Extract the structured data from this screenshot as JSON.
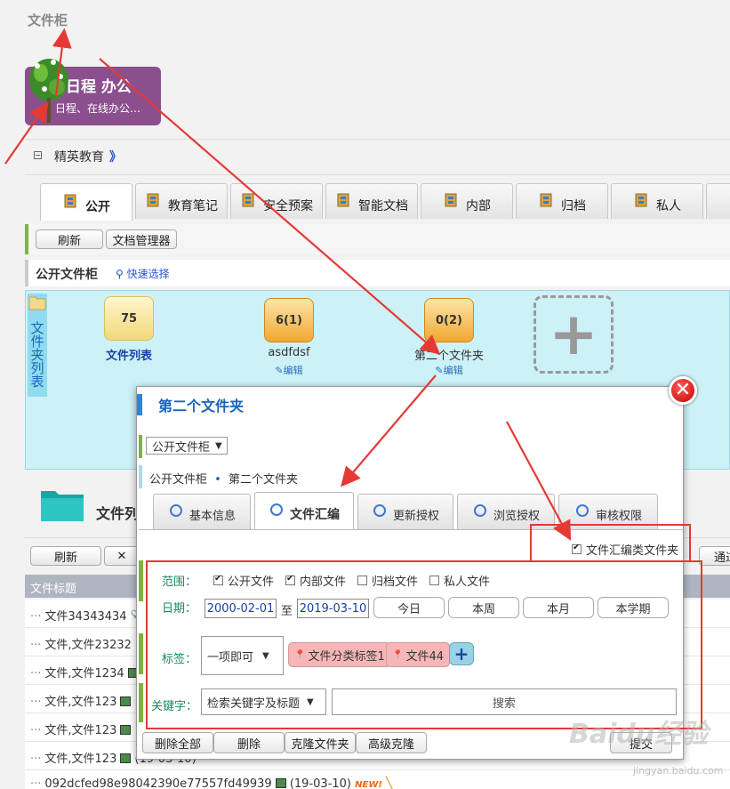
{
  "page": {
    "title": "文件柜"
  },
  "banner": {
    "line1": "日程 办公",
    "line2": "日程、在线办公…"
  },
  "breadcrumb": {
    "label": "精英教育",
    "arrow": "》"
  },
  "tabs": [
    {
      "label": "公开",
      "active": true,
      "icon": "cabinet-icon"
    },
    {
      "label": "教育笔记",
      "icon": "cabinet-icon"
    },
    {
      "label": "安全预案",
      "icon": "cabinet-icon"
    },
    {
      "label": "智能文档",
      "icon": "doc-icon"
    },
    {
      "label": "内部",
      "icon": "cabinet-icon"
    },
    {
      "label": "归档",
      "icon": "cabinet-icon"
    },
    {
      "label": "私人",
      "icon": "cabinet-icon"
    },
    {
      "label": "",
      "icon": "cabinet-icon"
    }
  ],
  "toolbar": {
    "refresh": "刷新",
    "doc_manager": "文档管理器"
  },
  "cabinet": {
    "title": "公开文件柜",
    "quick_select": "快速选择"
  },
  "side_label": "文件夹列表",
  "folders": [
    {
      "count": "75",
      "name": "文件列表"
    },
    {
      "count": "6(1)",
      "name": "asdfdsf",
      "edit": "编辑"
    },
    {
      "count": "0(2)",
      "name": "第二个文件夹",
      "edit": "编辑"
    }
  ],
  "file_list": {
    "title": "文件列",
    "refresh": "刷新",
    "pass": "通过",
    "column": "文件标题",
    "rows": [
      {
        "title": "文件34343434",
        "suffix": ""
      },
      {
        "title": "文件,文件23232",
        "suffix": ""
      },
      {
        "title": "文件,文件1234",
        "suffix": ""
      },
      {
        "title": "文件,文件123",
        "suffix": ""
      },
      {
        "title": "文件,文件123",
        "suffix": ""
      },
      {
        "title": "文件,文件123",
        "suffix": "(19-03-10)"
      },
      {
        "title": "092dcfed98e98042390e77557fd49939",
        "suffix": "(19-03-10)",
        "new": "NEW!"
      }
    ]
  },
  "dialog": {
    "title": "第二个文件夹",
    "cabinet_select": "公开文件柜",
    "path_root": "公开文件柜",
    "path_sep": "•",
    "path_leaf": "第二个文件夹",
    "tabs": [
      {
        "label": "基本信息",
        "icon": "settings-icon"
      },
      {
        "label": "文件汇编",
        "icon": "search-icon",
        "active": true
      },
      {
        "label": "更新授权",
        "icon": "refresh-icon"
      },
      {
        "label": "浏览授权",
        "icon": "key-icon"
      },
      {
        "label": "审核权限",
        "icon": "check-icon"
      }
    ],
    "compile_checkbox": {
      "label": "文件汇编类文件夹",
      "checked": true
    },
    "scope": {
      "label": "范围：",
      "options": [
        {
          "label": "公开文件",
          "checked": true
        },
        {
          "label": "内部文件",
          "checked": true
        },
        {
          "label": "归档文件",
          "checked": false
        },
        {
          "label": "私人文件",
          "checked": false
        }
      ]
    },
    "date": {
      "label": "日期：",
      "from": "2000-02-01",
      "sep": "至",
      "to": "2019-03-10",
      "buttons": [
        "今日",
        "本周",
        "本月",
        "本学期"
      ]
    },
    "tags": {
      "label": "标签：",
      "mode": "一项即可",
      "items": [
        "文件分类标签1",
        "文件44"
      ],
      "add": "+"
    },
    "keyword": {
      "label": "关键字：",
      "field": "检索关键字及标题",
      "search": "搜索"
    },
    "footer": {
      "delete_all": "删除全部",
      "delete": "删除",
      "clone": "克隆文件夹",
      "adv_clone": "高级克隆",
      "submit": "提交"
    }
  },
  "watermark": {
    "text": "Baidu经验",
    "url": "jingyan.baidu.com"
  },
  "colors": {
    "accent_green": "#7cb342",
    "annotation_red": "#e53935",
    "dialog_title": "#1565c0",
    "folder_area": "#ccf1f7"
  }
}
